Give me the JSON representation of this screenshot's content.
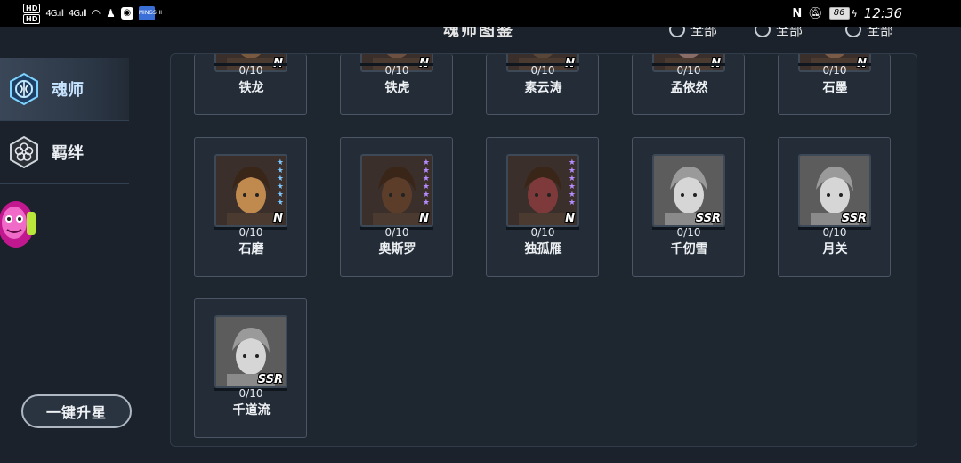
{
  "status_bar": {
    "left_hd": [
      "HD",
      "HD"
    ],
    "signals": [
      "4G",
      "4G"
    ],
    "app_badge": "MINGSHI",
    "battery": "86",
    "time": "12:36"
  },
  "header": {
    "title": "魂师图鉴",
    "filters": [
      "全部",
      "全部",
      "全部"
    ]
  },
  "sidebar": {
    "items": [
      {
        "label": "魂师",
        "icon": "soul-master-icon",
        "active": true
      },
      {
        "label": "羁绊",
        "icon": "bond-flower-icon",
        "active": false
      }
    ],
    "pet_icon": "pink-pet-icon"
  },
  "onekey_button": "一键升星",
  "cards": [
    {
      "name": "铁龙",
      "fragments": "0/10",
      "rarity": "N",
      "gray": false,
      "tone": "#7a5a3e"
    },
    {
      "name": "铁虎",
      "fragments": "0/10",
      "rarity": "N",
      "gray": false,
      "tone": "#6d5040"
    },
    {
      "name": "素云涛",
      "fragments": "0/10",
      "rarity": "N",
      "gray": false,
      "tone": "#5a4636"
    },
    {
      "name": "孟依然",
      "fragments": "0/10",
      "rarity": "N",
      "gray": false,
      "tone": "#8a6d66"
    },
    {
      "name": "石墨",
      "fragments": "0/10",
      "rarity": "N",
      "gray": false,
      "tone": "#7b5b46"
    },
    {
      "name": "石磨",
      "fragments": "0/10",
      "rarity": "N",
      "gray": false,
      "tone": "#c08a4f",
      "stars": 6,
      "star_color": "#7cc7ff"
    },
    {
      "name": "奥斯罗",
      "fragments": "0/10",
      "rarity": "N",
      "gray": false,
      "tone": "#5c3d2a",
      "stars": 6,
      "star_color": "#b48cff"
    },
    {
      "name": "独孤雁",
      "fragments": "0/10",
      "rarity": "N",
      "gray": false,
      "tone": "#7e3a3a",
      "stars": 6,
      "star_color": "#b48cff"
    },
    {
      "name": "千仞雪",
      "fragments": "0/10",
      "rarity": "SSR",
      "gray": true,
      "tone": "#bdbdbd"
    },
    {
      "name": "月关",
      "fragments": "0/10",
      "rarity": "SSR",
      "gray": true,
      "tone": "#c4c4c4"
    },
    {
      "name": "千道流",
      "fragments": "0/10",
      "rarity": "SSR",
      "gray": true,
      "tone": "#b0b0b0"
    }
  ]
}
